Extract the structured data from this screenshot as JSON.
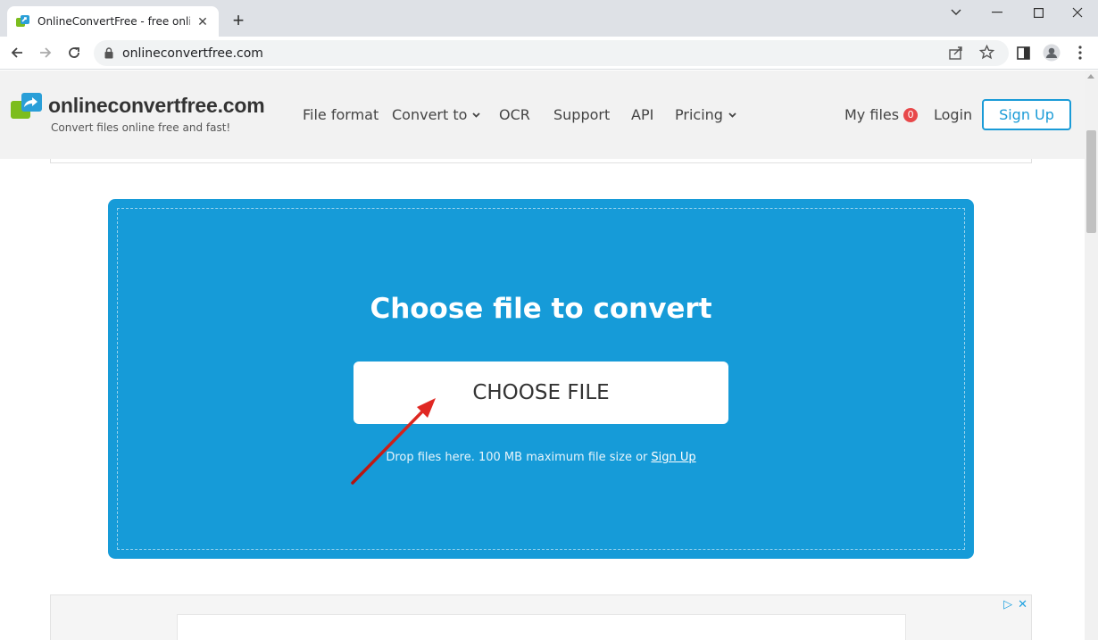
{
  "browser": {
    "tab_title": "OnlineConvertFree - free online",
    "url": "onlineconvertfree.com"
  },
  "site": {
    "logo_text": "onlineconvertfree.com",
    "tagline": "Convert files online free and fast!",
    "nav": [
      {
        "label": "File format"
      },
      {
        "label": "Convert to",
        "dropdown": true
      },
      {
        "label": "OCR"
      },
      {
        "label": "Support"
      },
      {
        "label": "API"
      },
      {
        "label": "Pricing",
        "dropdown": true
      }
    ],
    "my_files_label": "My files",
    "my_files_count": "0",
    "login_label": "Login",
    "signup_label": "Sign Up"
  },
  "upload": {
    "title": "Choose file to convert",
    "button_label": "CHOOSE FILE",
    "note": "Drop files here. 100 MB maximum file size or",
    "note_link": "Sign Up"
  },
  "colors": {
    "accent": "#169bd8",
    "badge": "#e8484a",
    "arrow": "#d9201e"
  }
}
